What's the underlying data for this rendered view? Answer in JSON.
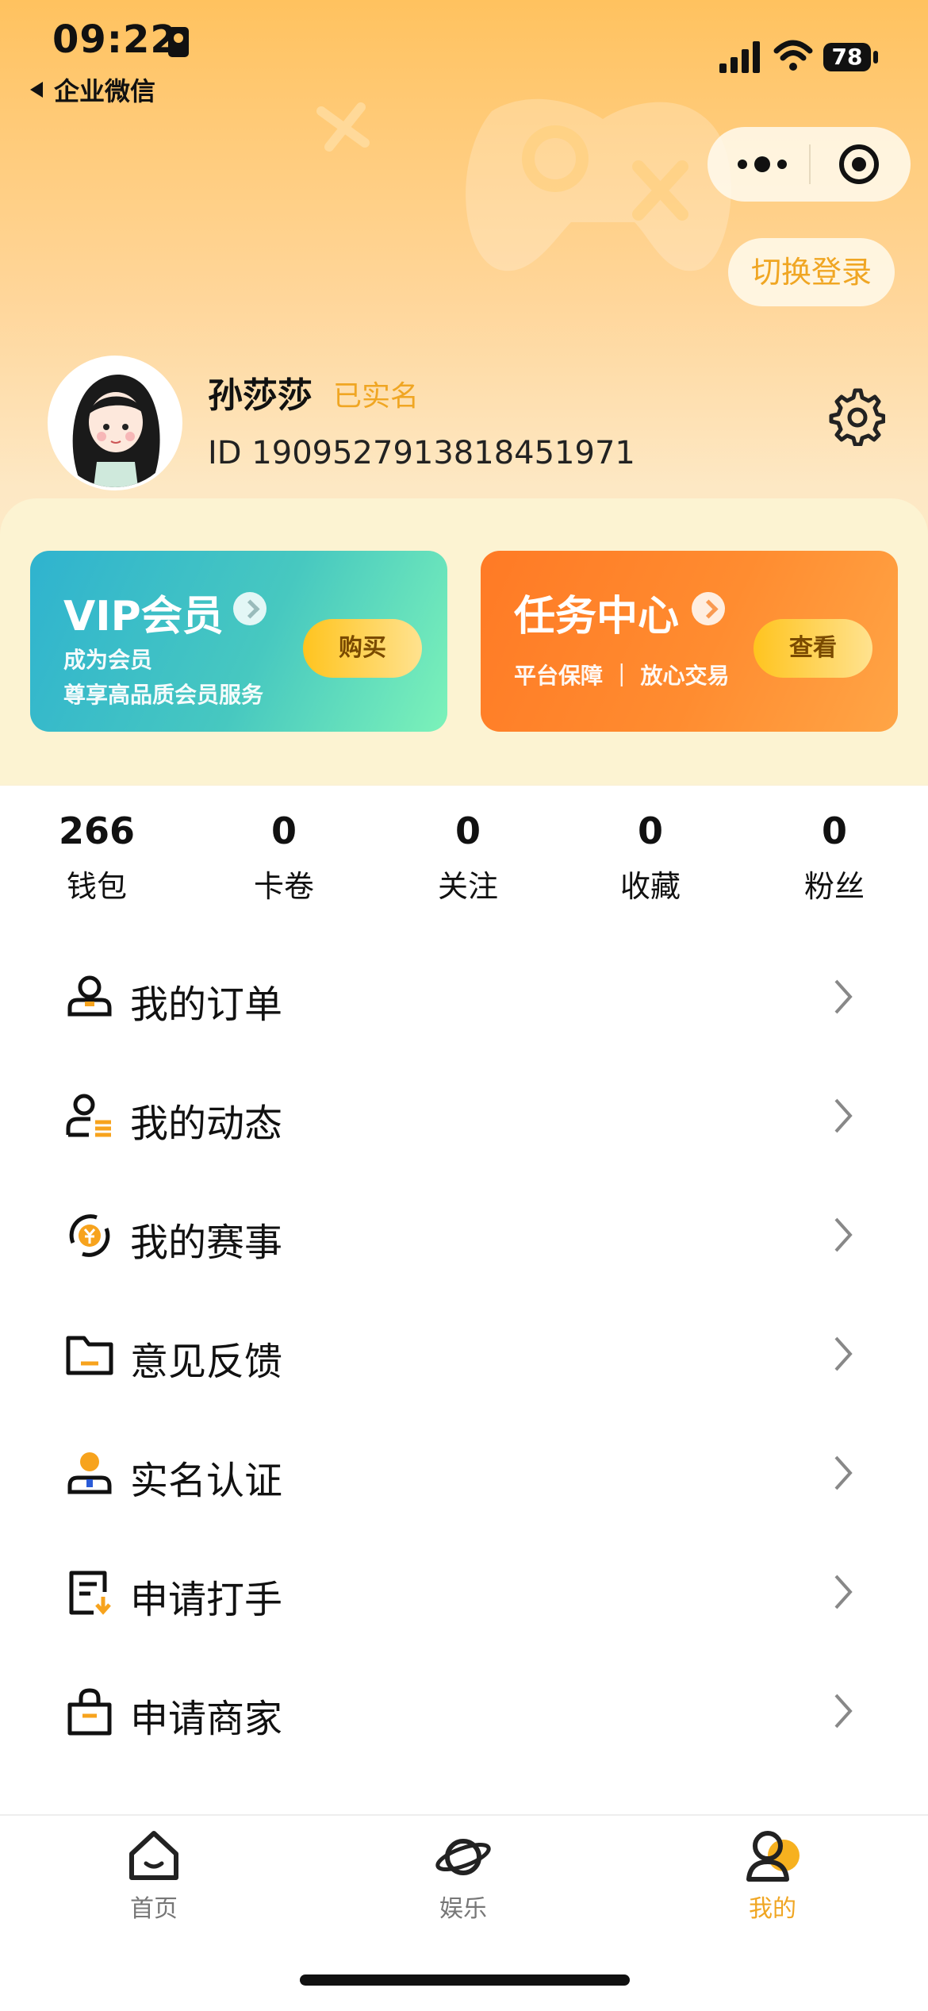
{
  "status_bar": {
    "time": "09:22",
    "back_app": "企业微信",
    "battery": "78"
  },
  "header": {
    "switch_login": "切换登录"
  },
  "profile": {
    "name": "孙莎莎",
    "verified": "已实名",
    "id": "ID 1909527913818451971"
  },
  "cards": {
    "vip": {
      "title": "VIP会员",
      "line1": "成为会员",
      "line2": "尊享高品质会员服务",
      "button": "购买"
    },
    "task": {
      "title": "任务中心",
      "line1": "平台保障 ｜ 放心交易",
      "button": "查看"
    }
  },
  "stats": [
    {
      "value": "266",
      "label": "钱包"
    },
    {
      "value": "0",
      "label": "卡卷"
    },
    {
      "value": "0",
      "label": "关注"
    },
    {
      "value": "0",
      "label": "收藏"
    },
    {
      "value": "0",
      "label": "粉丝"
    }
  ],
  "menu": [
    {
      "label": "我的订单",
      "icon": "order-icon"
    },
    {
      "label": "我的动态",
      "icon": "user-list-icon"
    },
    {
      "label": "我的赛事",
      "icon": "yuan-refresh-icon"
    },
    {
      "label": "意见反馈",
      "icon": "folder-icon"
    },
    {
      "label": "实名认证",
      "icon": "id-person-icon"
    },
    {
      "label": "申请打手",
      "icon": "document-download-icon"
    },
    {
      "label": "申请商家",
      "icon": "shopping-bag-icon"
    }
  ],
  "tabbar": [
    {
      "label": "首页",
      "icon": "home-icon"
    },
    {
      "label": "娱乐",
      "icon": "planet-icon"
    },
    {
      "label": "我的",
      "icon": "profile-icon",
      "active": true
    }
  ],
  "colors": {
    "accent": "#f0a623",
    "header_top": "#ffc25f",
    "vip_card": "#2fb3cf",
    "task_card": "#ff7a25"
  }
}
